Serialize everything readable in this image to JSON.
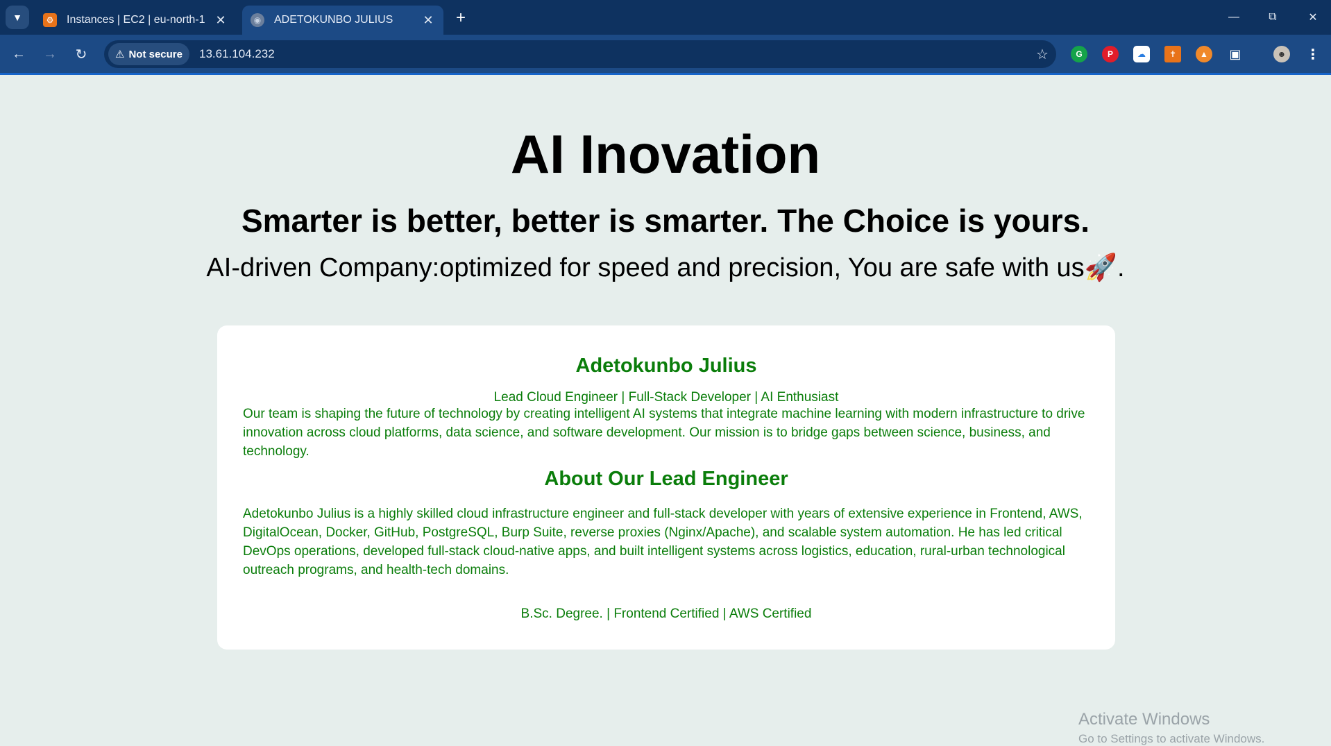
{
  "browser": {
    "tabs": [
      {
        "title": "Instances | EC2 | eu-north-1",
        "favicon": "aws-console-icon",
        "active": false
      },
      {
        "title": "ADETOKUNBO JULIUS",
        "favicon": "globe-icon",
        "active": true
      }
    ],
    "security_label": "Not secure",
    "url": "13.61.104.232",
    "extensions": [
      "grammarly-icon",
      "pinterest-icon",
      "cloud-extension-icon",
      "tool-extension-icon",
      "metamask-icon",
      "extensions-puzzle-icon"
    ]
  },
  "page": {
    "hero_title": "AI Inovation",
    "tagline": "Smarter is better, better is smarter. The Choice is yours.",
    "subtitle": "AI-driven Company:optimized for speed and precision, You are safe with us🚀.",
    "card": {
      "name": "Adetokunbo Julius",
      "roles": "Lead Cloud Engineer | Full-Stack Developer | AI Enthusiast",
      "mission": "Our team is shaping the future of technology by creating intelligent AI systems that integrate machine learning with modern infrastructure to drive innovation across cloud platforms, data science, and software development. Our mission is to bridge gaps between science, business, and technology.",
      "about_heading": "About Our Lead Engineer",
      "about_text": "Adetokunbo Julius is a highly skilled cloud infrastructure engineer and full-stack developer with years of extensive experience in Frontend, AWS, DigitalOcean, Docker, GitHub, PostgreSQL, Burp Suite, reverse proxies (Nginx/Apache), and scalable system automation. He has led critical DevOps operations, developed full-stack cloud-native apps, and built intelligent systems across logistics, education, rural-urban technological outreach programs, and health-tech domains.",
      "credentials": "B.Sc. Degree. | Frontend Certified | AWS Certified"
    }
  },
  "watermark": {
    "line1": "Activate Windows",
    "line2": "Go to Settings to activate Windows."
  },
  "colors": {
    "page_bg": "#e6eeec",
    "accent_green": "#0a7d0a",
    "chrome_dark": "#0e3260",
    "chrome_toolbar": "#1c4a85"
  }
}
